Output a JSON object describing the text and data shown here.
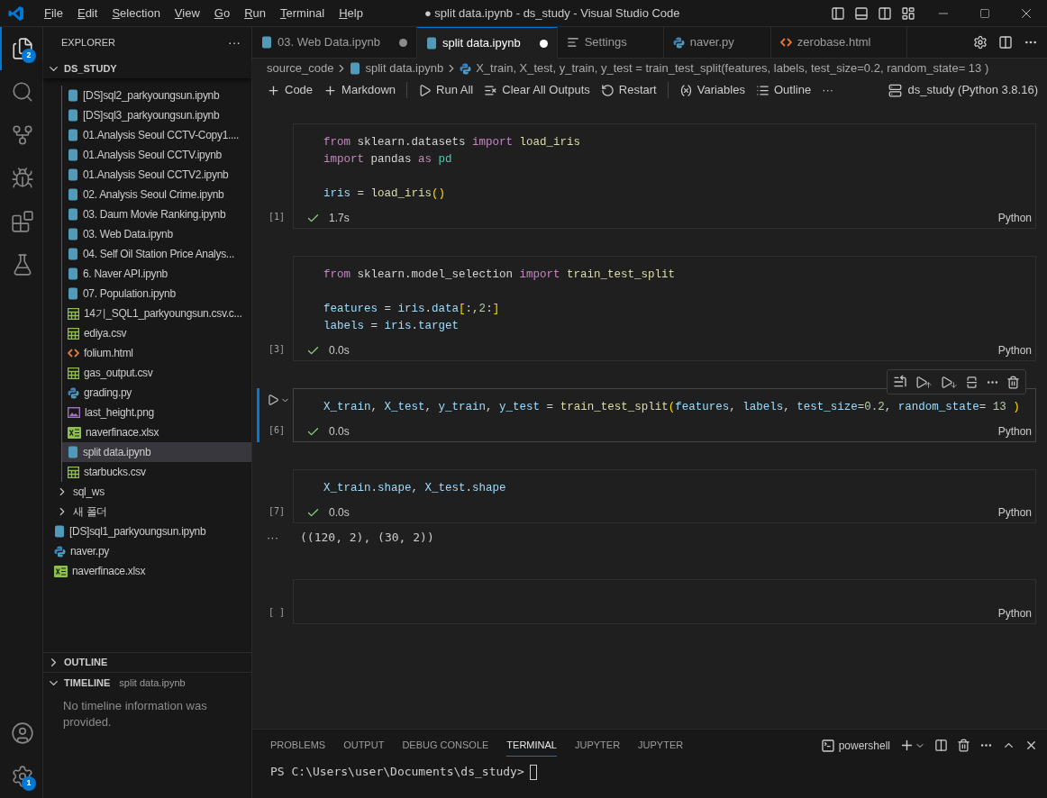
{
  "title_bar": {
    "menu": [
      "File",
      "Edit",
      "Selection",
      "View",
      "Go",
      "Run",
      "Terminal",
      "Help"
    ],
    "title": "● split data.ipynb - ds_study - Visual Studio Code"
  },
  "activity_bar": {
    "top": [
      {
        "kind": "explorer",
        "selected": true,
        "badge": "2"
      },
      {
        "kind": "search",
        "selected": false
      },
      {
        "kind": "source_control",
        "selected": false
      },
      {
        "kind": "run_debug",
        "selected": false
      },
      {
        "kind": "extensions",
        "selected": false
      },
      {
        "kind": "testing",
        "selected": false
      }
    ],
    "bottom": [
      {
        "kind": "account"
      },
      {
        "kind": "manage",
        "badge": "1"
      }
    ]
  },
  "sidebar": {
    "title": "EXPLORER",
    "more": "···",
    "root": {
      "label": "DS_STUDY",
      "expanded": true
    },
    "tree": [
      {
        "kind": "scrolled_folder",
        "children": [
          {
            "kind": "notebook",
            "label": "[DS]sql2_parkyoungsun.ipynb",
            "selected": false
          },
          {
            "kind": "notebook",
            "label": "[DS]sql3_parkyoungsun.ipynb",
            "selected": false
          },
          {
            "kind": "notebook",
            "label": "01.Analysis Seoul CCTV-Copy1....",
            "selected": false
          },
          {
            "kind": "notebook",
            "label": "01.Analysis Seoul CCTV.ipynb",
            "selected": false
          },
          {
            "kind": "notebook",
            "label": "01.Analysis Seoul CCTV2.ipynb",
            "selected": false
          },
          {
            "kind": "notebook",
            "label": "02. Analysis Seoul Crime.ipynb",
            "selected": false
          },
          {
            "kind": "notebook",
            "label": "03. Daum Movie Ranking.ipynb",
            "selected": false
          },
          {
            "kind": "notebook",
            "label": "03. Web Data.ipynb",
            "selected": false
          },
          {
            "kind": "notebook",
            "label": "04. Self Oil Station Price Analys...",
            "selected": false
          },
          {
            "kind": "notebook",
            "label": "6. Naver API.ipynb",
            "selected": false
          },
          {
            "kind": "notebook",
            "label": "07. Population.ipynb",
            "selected": false
          },
          {
            "kind": "csv",
            "label": "14기_SQL1_parkyoungsun.csv.c...",
            "selected": false
          },
          {
            "kind": "csv",
            "label": "ediya.csv",
            "selected": false
          },
          {
            "kind": "html",
            "label": "folium.html",
            "selected": false
          },
          {
            "kind": "csv",
            "label": "gas_output.csv",
            "selected": false
          },
          {
            "kind": "python",
            "label": "grading.py",
            "selected": false
          },
          {
            "kind": "image",
            "label": "last_height.png",
            "selected": false
          },
          {
            "kind": "excel",
            "label": "naverfinace.xlsx",
            "selected": false
          },
          {
            "kind": "notebook",
            "label": "split data.ipynb",
            "selected": true
          },
          {
            "kind": "csv",
            "label": "starbucks.csv",
            "selected": false
          }
        ]
      },
      {
        "kind": "folder",
        "label": "sql_ws",
        "expanded": false
      },
      {
        "kind": "folder",
        "label": "새 폴더",
        "expanded": false
      },
      {
        "kind": "notebook",
        "label": "[DS]sql1_parkyoungsun.ipynb",
        "selected": false
      },
      {
        "kind": "python",
        "label": "naver.py",
        "selected": false
      },
      {
        "kind": "excel",
        "label": "naverfinace.xlsx",
        "selected": false
      }
    ],
    "outline": {
      "label": "OUTLINE",
      "expanded": false
    },
    "timeline": {
      "label": "TIMELINE",
      "expanded": true,
      "subtitle": "split data.ipynb",
      "message": "No timeline information was provided."
    }
  },
  "editor_tabs": [
    {
      "kind": "notebook",
      "label": "03. Web Data.ipynb",
      "selected": false,
      "dirty": true
    },
    {
      "kind": "notebook",
      "label": "split data.ipynb",
      "selected": true,
      "dirty": true
    },
    {
      "kind": "settings",
      "label": "Settings",
      "selected": false,
      "dirty": false
    },
    {
      "kind": "python",
      "label": "naver.py",
      "selected": false,
      "dirty": false
    },
    {
      "kind": "html",
      "label": "zerobase.html",
      "selected": false,
      "dirty": false
    }
  ],
  "breadcrumb": [
    {
      "kind": "folder",
      "label": "source_code"
    },
    {
      "kind": "notebook",
      "label": "split data.ipynb"
    },
    {
      "kind": "python",
      "label": "X_train, X_test, y_train, y_test = train_test_split(features, labels, test_size=0.2, random_state= 13 )"
    }
  ],
  "notebook_toolbar": {
    "items": [
      {
        "kind": "code",
        "label": "Code"
      },
      {
        "kind": "markdown",
        "label": "Markdown"
      },
      {
        "kind": "separator"
      },
      {
        "kind": "run_all",
        "label": "Run All"
      },
      {
        "kind": "clear",
        "label": "Clear All Outputs"
      },
      {
        "kind": "restart",
        "label": "Restart"
      },
      {
        "kind": "separator"
      },
      {
        "kind": "variables",
        "label": "Variables"
      },
      {
        "kind": "outline",
        "label": "Outline"
      },
      {
        "kind": "more",
        "label": "···"
      }
    ],
    "kernel": "ds_study (Python 3.8.16)"
  },
  "cells": [
    {
      "count": "[1]",
      "selected": false,
      "status": "1.7s",
      "language": "Python",
      "lines": [
        {
          "kind": "code",
          "tokens": [
            {
              "kind": "keyword",
              "text": "from "
            },
            {
              "kind": "plain",
              "text": "sklearn.datasets "
            },
            {
              "kind": "keyword",
              "text": "import "
            },
            {
              "kind": "function",
              "text": "load_iris"
            }
          ]
        },
        {
          "kind": "code",
          "tokens": [
            {
              "kind": "keyword",
              "text": "import "
            },
            {
              "kind": "plain",
              "text": "pandas "
            },
            {
              "kind": "keyword",
              "text": "as "
            },
            {
              "kind": "class",
              "text": "pd"
            }
          ]
        },
        {
          "kind": "blank"
        },
        {
          "kind": "code",
          "tokens": [
            {
              "kind": "variable",
              "text": "iris"
            },
            {
              "kind": "plain",
              "text": " = "
            },
            {
              "kind": "function",
              "text": "load_iris"
            },
            {
              "kind": "bracket",
              "text": "()"
            }
          ]
        }
      ]
    },
    {
      "count": "[3]",
      "selected": false,
      "status": "0.0s",
      "language": "Python",
      "lines": [
        {
          "kind": "code",
          "tokens": [
            {
              "kind": "keyword",
              "text": "from "
            },
            {
              "kind": "plain",
              "text": "sklearn.model_selection "
            },
            {
              "kind": "keyword",
              "text": "import "
            },
            {
              "kind": "function",
              "text": "train_test_split"
            }
          ]
        },
        {
          "kind": "blank"
        },
        {
          "kind": "code",
          "tokens": [
            {
              "kind": "variable",
              "text": "features"
            },
            {
              "kind": "plain",
              "text": " = "
            },
            {
              "kind": "variable",
              "text": "iris"
            },
            {
              "kind": "plain",
              "text": "."
            },
            {
              "kind": "variable",
              "text": "data"
            },
            {
              "kind": "bracket",
              "text": "["
            },
            {
              "kind": "plain",
              "text": ":,"
            },
            {
              "kind": "number",
              "text": "2"
            },
            {
              "kind": "plain",
              "text": ":"
            },
            {
              "kind": "bracket",
              "text": "]"
            }
          ]
        },
        {
          "kind": "code",
          "tokens": [
            {
              "kind": "variable",
              "text": "labels"
            },
            {
              "kind": "plain",
              "text": " = "
            },
            {
              "kind": "variable",
              "text": "iris"
            },
            {
              "kind": "plain",
              "text": "."
            },
            {
              "kind": "variable",
              "text": "target"
            }
          ]
        }
      ]
    },
    {
      "count": "[6]",
      "selected": true,
      "status": "0.0s",
      "language": "Python",
      "lines": [
        {
          "kind": "code",
          "tokens": [
            {
              "kind": "variable",
              "text": "X_train"
            },
            {
              "kind": "plain",
              "text": ", "
            },
            {
              "kind": "variable",
              "text": "X_test"
            },
            {
              "kind": "plain",
              "text": ", "
            },
            {
              "kind": "variable",
              "text": "y_train"
            },
            {
              "kind": "plain",
              "text": ", "
            },
            {
              "kind": "variable",
              "text": "y_test"
            },
            {
              "kind": "plain",
              "text": " = "
            },
            {
              "kind": "function",
              "text": "train_test_split"
            },
            {
              "kind": "bracket",
              "text": "("
            },
            {
              "kind": "variable",
              "text": "features"
            },
            {
              "kind": "plain",
              "text": ", "
            },
            {
              "kind": "variable",
              "text": "labels"
            },
            {
              "kind": "plain",
              "text": ", "
            },
            {
              "kind": "variable",
              "text": "test_size"
            },
            {
              "kind": "plain",
              "text": "="
            },
            {
              "kind": "number",
              "text": "0.2"
            },
            {
              "kind": "plain",
              "text": ", "
            },
            {
              "kind": "variable",
              "text": "random_state"
            },
            {
              "kind": "plain",
              "text": "= "
            },
            {
              "kind": "number",
              "text": "13 "
            },
            {
              "kind": "bracket",
              "text": ")"
            }
          ]
        }
      ]
    },
    {
      "count": "[7]",
      "selected": false,
      "status": "0.0s",
      "language": "Python",
      "lines": [
        {
          "kind": "code",
          "tokens": [
            {
              "kind": "variable",
              "text": "X_train"
            },
            {
              "kind": "plain",
              "text": "."
            },
            {
              "kind": "variable",
              "text": "shape"
            },
            {
              "kind": "plain",
              "text": ", "
            },
            {
              "kind": "variable",
              "text": "X_test"
            },
            {
              "kind": "plain",
              "text": "."
            },
            {
              "kind": "variable",
              "text": "shape"
            }
          ]
        }
      ],
      "output_marker": "···",
      "output": "((120, 2), (30, 2))"
    },
    {
      "count": "[ ]",
      "selected": false,
      "language": "Python"
    }
  ],
  "panel": {
    "tabs": [
      {
        "label": "PROBLEMS",
        "selected": false
      },
      {
        "label": "OUTPUT",
        "selected": false
      },
      {
        "label": "DEBUG CONSOLE",
        "selected": false
      },
      {
        "label": "TERMINAL",
        "selected": true
      },
      {
        "label": "JUPYTER",
        "selected": false
      },
      {
        "label": "JUPYTER",
        "selected": false
      }
    ],
    "shell": "powershell",
    "prompt": "PS C:\\Users\\user\\Documents\\ds_study>"
  }
}
